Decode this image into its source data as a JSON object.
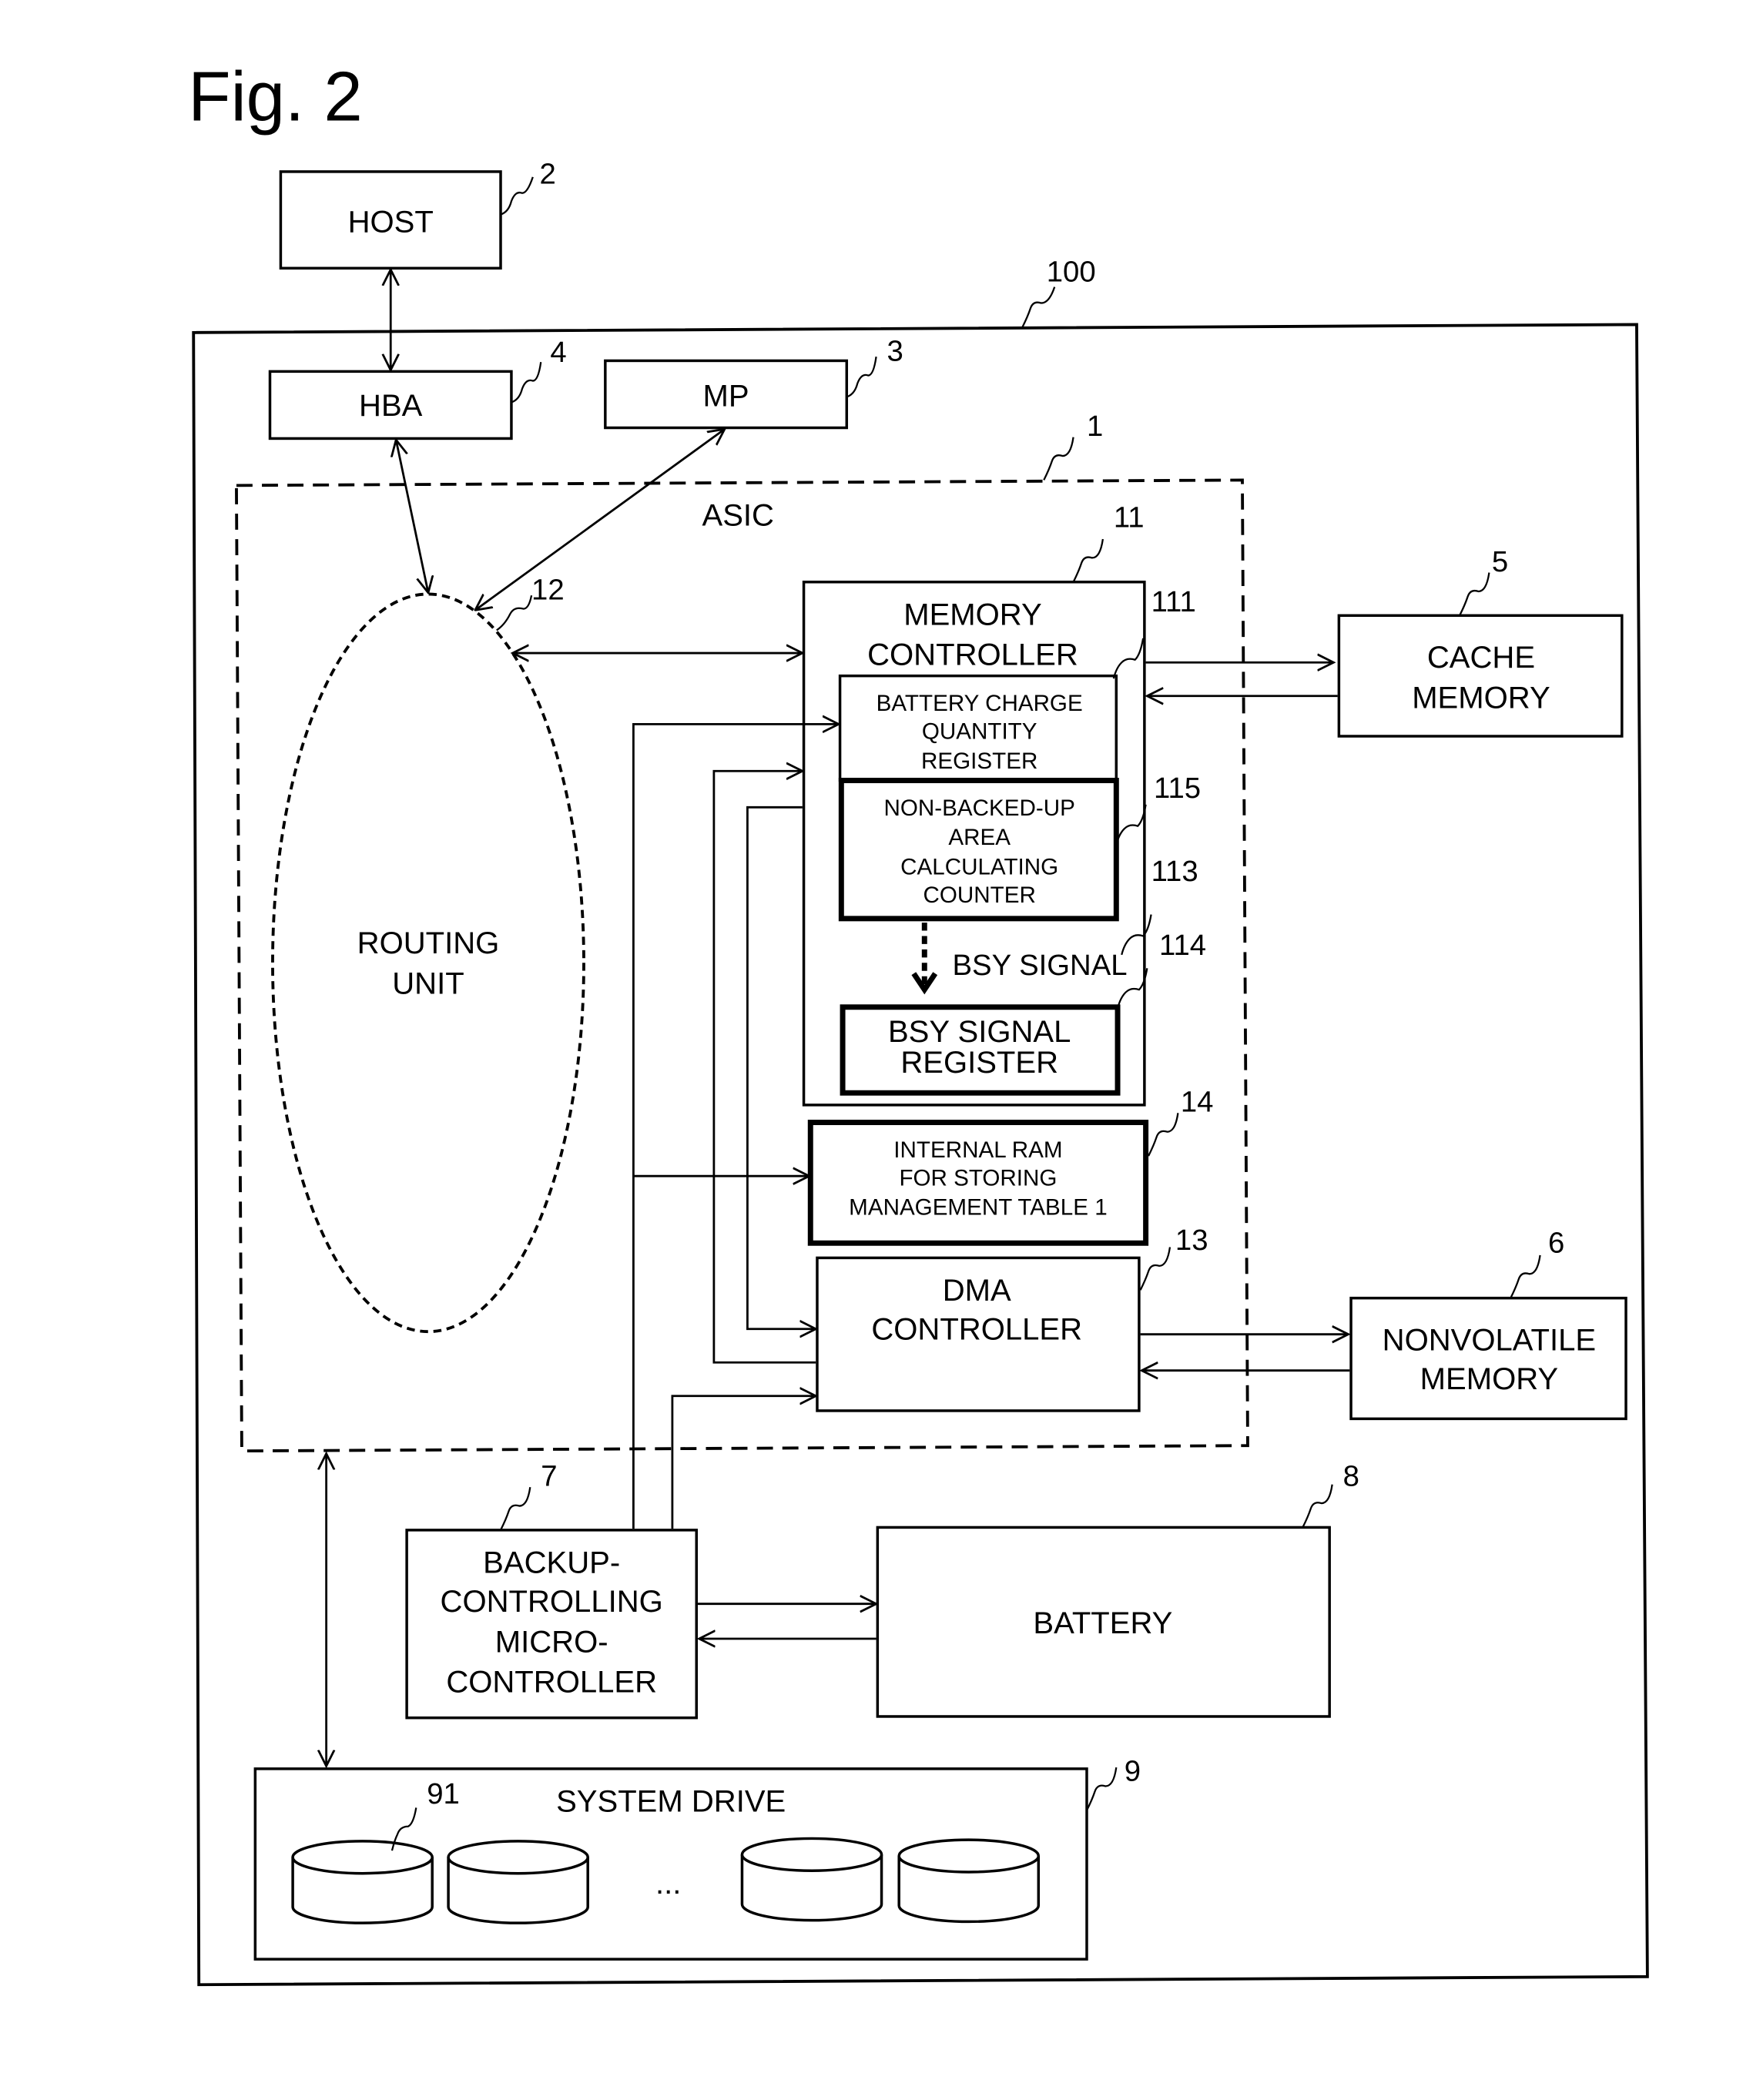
{
  "figure": {
    "title": "Fig. 2"
  },
  "components": {
    "host": {
      "label": "HOST",
      "ref": "2"
    },
    "system": {
      "ref": "100"
    },
    "hba": {
      "label": "HBA",
      "ref": "4"
    },
    "mp": {
      "label": "MP",
      "ref": "3"
    },
    "asic": {
      "label": "ASIC",
      "ref": "1"
    },
    "routing_unit": {
      "label_lines": [
        "ROUTING",
        "UNIT"
      ],
      "ref": "12"
    },
    "memory_controller": {
      "label_lines": [
        "MEMORY",
        "CONTROLLER"
      ],
      "ref": "11"
    },
    "battery_charge_register": {
      "label_lines": [
        "BATTERY CHARGE",
        "QUANTITY",
        "REGISTER"
      ],
      "ref": "111"
    },
    "non_backed_up_counter": {
      "label_lines": [
        "NON-BACKED-UP",
        "AREA",
        "CALCULATING",
        "COUNTER"
      ],
      "ref": "115"
    },
    "bsy_signal": {
      "label": "BSY SIGNAL",
      "ref": "113"
    },
    "bsy_signal_register": {
      "label_lines": [
        "BSY SIGNAL",
        "REGISTER"
      ],
      "ref": "114"
    },
    "internal_ram": {
      "label_lines": [
        "INTERNAL RAM",
        "FOR STORING",
        "MANAGEMENT TABLE 1"
      ],
      "ref": "14"
    },
    "dma_controller": {
      "label_lines": [
        "DMA",
        "CONTROLLER"
      ],
      "ref": "13"
    },
    "cache_memory": {
      "label_lines": [
        "CACHE",
        "MEMORY"
      ],
      "ref": "5"
    },
    "nonvolatile_memory": {
      "label_lines": [
        "NONVOLATILE",
        "MEMORY"
      ],
      "ref": "6"
    },
    "backup_microcontroller": {
      "label_lines": [
        "BACKUP-",
        "CONTROLLING",
        "MICRO-",
        "CONTROLLER"
      ],
      "ref": "7"
    },
    "battery": {
      "label": "BATTERY",
      "ref": "8"
    },
    "system_drive": {
      "label": "SYSTEM DRIVE",
      "ref": "9",
      "drive_ref": "91",
      "ellipsis": "..."
    }
  }
}
